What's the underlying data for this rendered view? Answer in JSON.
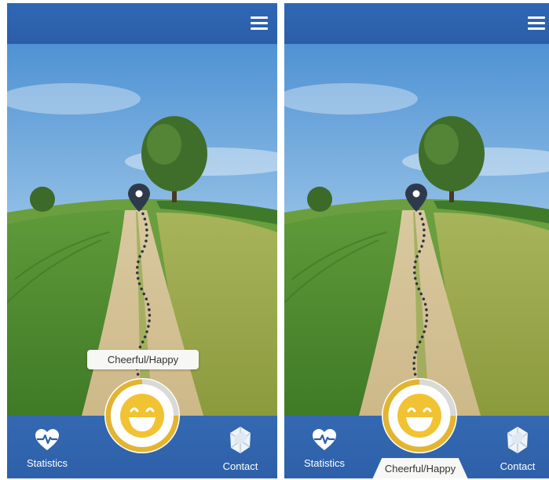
{
  "screens": [
    {
      "nav": {
        "statistics_label": "Statistics",
        "contact_label": "Contact"
      },
      "mood": {
        "label": "Cheerful/Happy",
        "label_position": "above-indicator"
      }
    },
    {
      "nav": {
        "statistics_label": "Statistics",
        "contact_label": "Contact"
      },
      "mood": {
        "label": "Cheerful/Happy",
        "label_position": "bottom-tab"
      }
    }
  ],
  "icons": {
    "menu": "hamburger-icon",
    "statistics": "heart-pulse-icon",
    "contact": "contact-icon",
    "location": "map-pin-icon",
    "mood": "happy-face-icon"
  },
  "colors": {
    "bar_blue": "#2d62ab",
    "mood_yellow": "#f1c232",
    "ring_yellow": "#e2b431",
    "pin_dark": "#2e3a4b",
    "path_dots": "#2c3440"
  }
}
